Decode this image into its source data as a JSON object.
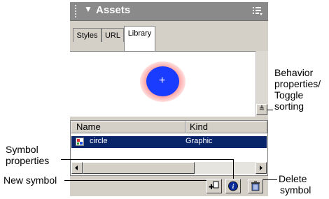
{
  "panel": {
    "title": "Assets",
    "tabs": [
      {
        "label": "Styles",
        "active": false
      },
      {
        "label": "URL",
        "active": false
      },
      {
        "label": "Library",
        "active": true
      }
    ],
    "preview": {
      "symbol_color": "#1a3cff",
      "glow_color": "#ff6a6a"
    },
    "list": {
      "columns": [
        "Name",
        "Kind"
      ],
      "rows": [
        {
          "name": "circle",
          "kind": "Graphic",
          "selected": true
        }
      ]
    },
    "icons": {
      "options": "options-menu-icon",
      "sort": "toggle-sort-icon",
      "new": "new-symbol-icon",
      "properties": "symbol-properties-icon",
      "delete": "trash-icon"
    }
  },
  "callouts": {
    "behavior_properties": [
      "Behavior",
      "properties/",
      "Toggle",
      "sorting"
    ],
    "symbol_properties": [
      "Symbol",
      "properties"
    ],
    "new_symbol": "New symbol",
    "delete_symbol": [
      "Delete",
      "symbol"
    ]
  },
  "colors": {
    "selection": "#0a246a",
    "panel_bg": "#d4d0c8",
    "titlebar": "#8a8a8a"
  }
}
